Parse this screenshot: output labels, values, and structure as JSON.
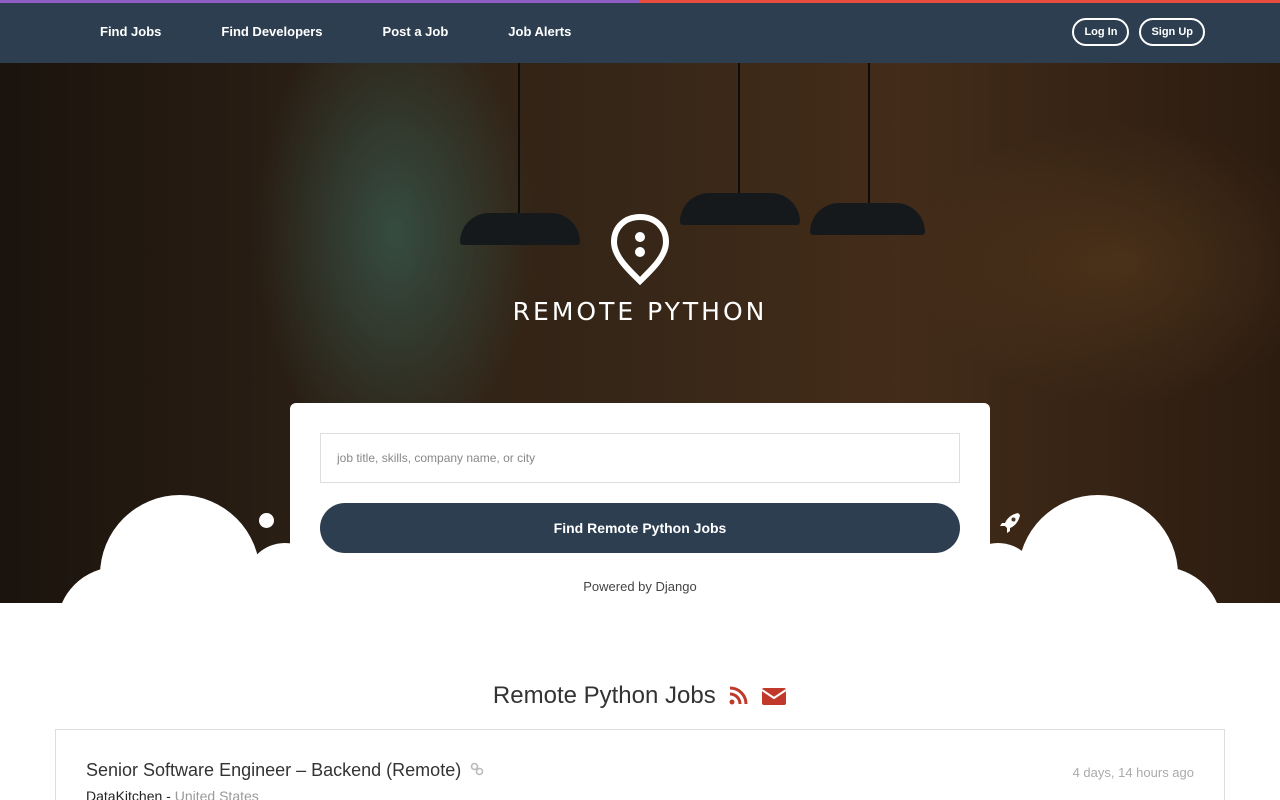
{
  "colors": {
    "navbar_bg": "#2c3e50",
    "accent_left": "#8e5ec4",
    "accent_right": "#e74c3c",
    "icon_red": "#c0392b",
    "button_bg": "#2c3e50"
  },
  "nav": {
    "items": [
      {
        "label": "Find Jobs"
      },
      {
        "label": "Find Developers"
      },
      {
        "label": "Post a Job"
      },
      {
        "label": "Job Alerts"
      }
    ],
    "login_label": "Log In",
    "signup_label": "Sign Up"
  },
  "hero": {
    "brand": "REMOTE PYTHON",
    "search_placeholder": "job title, skills, company name, or city",
    "search_button": "Find Remote Python Jobs",
    "powered_by": "Powered by Django"
  },
  "jobs_section": {
    "title": "Remote Python Jobs",
    "icons": [
      "rss-icon",
      "envelope-icon"
    ],
    "jobs": [
      {
        "title": "Senior Software Engineer – Backend (Remote)",
        "company": "DataKitchen",
        "separator": "-",
        "location": "United States",
        "posted": "4 days, 14 hours ago"
      }
    ]
  }
}
